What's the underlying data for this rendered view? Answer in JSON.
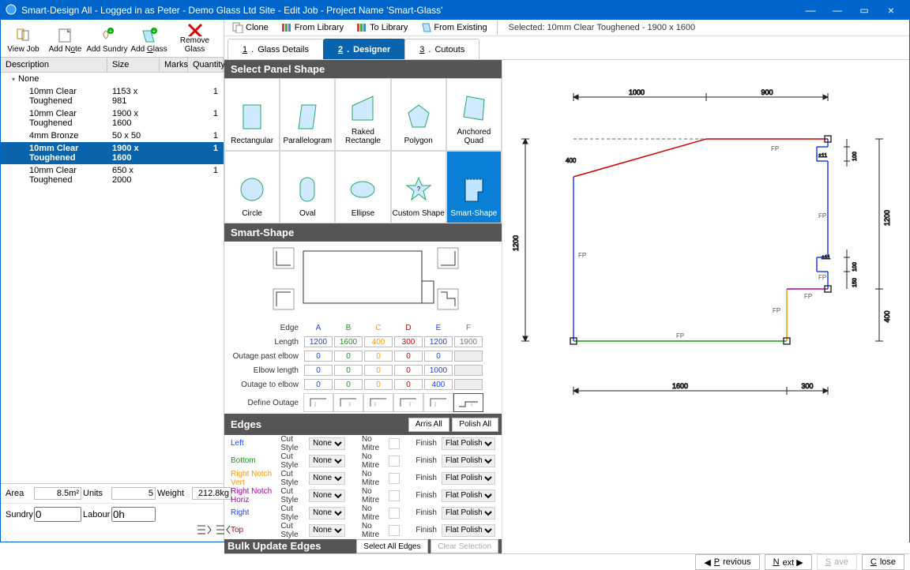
{
  "title": "Smart-Design All - Logged in as Peter - Demo Glass Ltd Site - Edit Job - Project Name 'Smart-Glass'",
  "wctrl": {
    "min": "—",
    "max": "▭",
    "close": "×",
    "dash": "––"
  },
  "left_toolbar": {
    "view": "View Job",
    "add_note": "Add Note",
    "add_sundry": "Add Sundry",
    "add_glass": "Add Glass",
    "remove_glass": "Remove Glass"
  },
  "list_head": {
    "desc": "Description",
    "size": "Size",
    "marks": "Marks",
    "qty": "Quantity"
  },
  "list_group": "None",
  "list": [
    {
      "desc": "10mm Clear Toughened",
      "size": "1153 x 981",
      "marks": "",
      "qty": "1"
    },
    {
      "desc": "10mm Clear Toughened",
      "size": "1900 x 1600",
      "marks": "",
      "qty": "1"
    },
    {
      "desc": "4mm Bronze",
      "size": "50 x 50",
      "marks": "",
      "qty": "1"
    },
    {
      "desc": "10mm Clear Toughened",
      "size": "1900 x 1600",
      "marks": "",
      "qty": "1",
      "sel": true
    },
    {
      "desc": "10mm Clear Toughened",
      "size": "650 x 2000",
      "marks": "",
      "qty": "1"
    }
  ],
  "totals": {
    "area_l": "Area",
    "area": "8.5m²",
    "units_l": "Units",
    "units": "5",
    "weight_l": "Weight",
    "weight": "212.8kg",
    "sundry_l": "Sundry",
    "sundry": "0",
    "labour_l": "Labour",
    "labour": "0h"
  },
  "rtool": {
    "clone": "Clone",
    "fromlib": "From Library",
    "tolib": "To Library",
    "fromex": "From Existing",
    "selected": "Selected: 10mm Clear Toughened - 1900 x 1600"
  },
  "tabs": [
    {
      "n": "1",
      "label": "Glass Details"
    },
    {
      "n": "2",
      "label": "Designer",
      "active": true
    },
    {
      "n": "3",
      "label": "Cutouts"
    }
  ],
  "sect": {
    "shape": "Select Panel Shape",
    "smart": "Smart-Shape",
    "edges": "Edges",
    "bulk": "Bulk Update Edges"
  },
  "shapes": [
    "Rectangular",
    "Parallelogram",
    "Raked Rectangle",
    "Polygon",
    "Anchored Quad",
    "Circle",
    "Oval",
    "Ellipse",
    "Custom Shape",
    "Smart-Shape"
  ],
  "smart": {
    "cols": [
      "A",
      "B",
      "C",
      "D",
      "E",
      "F"
    ],
    "edge_l": "Edge",
    "rows": [
      {
        "l": "Length",
        "v": [
          "1200",
          "1600",
          "400",
          "300",
          "1200",
          "1900"
        ]
      },
      {
        "l": "Outage past elbow",
        "v": [
          "0",
          "0",
          "0",
          "0",
          "0",
          ""
        ]
      },
      {
        "l": "Elbow length",
        "v": [
          "0",
          "0",
          "0",
          "0",
          "1000",
          ""
        ]
      },
      {
        "l": "Outage to elbow",
        "v": [
          "0",
          "0",
          "0",
          "0",
          "400",
          ""
        ]
      }
    ],
    "define": "Define Outage"
  },
  "edges_btns": {
    "arris": "Arris All",
    "polish": "Polish All"
  },
  "edges": [
    {
      "n": "Left",
      "cls": "e-left"
    },
    {
      "n": "Bottom",
      "cls": "e-bottom"
    },
    {
      "n": "Right Notch Vert",
      "cls": "e-rnv"
    },
    {
      "n": "Right Notch Horiz",
      "cls": "e-rnh"
    },
    {
      "n": "Right",
      "cls": "e-right"
    },
    {
      "n": "Top",
      "cls": "e-top"
    }
  ],
  "edge_labels": {
    "cut": "Cut Style",
    "mitre": "No Mitre",
    "finish": "Finish"
  },
  "edge_vals": {
    "cut": "None",
    "finish": "Flat Polish"
  },
  "bulk_btns": {
    "all": "Select All Edges",
    "clear": "Clear Selection"
  },
  "canvas": {
    "top_dims": [
      "1000",
      "900"
    ],
    "left_dim": "1200",
    "left_sub": "400",
    "right_dims": [
      "1200",
      "400"
    ],
    "right_sm": [
      "±11",
      "±1",
      "±11",
      "±1"
    ],
    "right_ss": [
      "100",
      "100",
      "100",
      "150"
    ],
    "bottom_dims": [
      "1600",
      "300"
    ],
    "fp": "FP"
  },
  "footer": {
    "prev": "Previous",
    "next": "Next",
    "save": "Save",
    "close": "Close"
  }
}
